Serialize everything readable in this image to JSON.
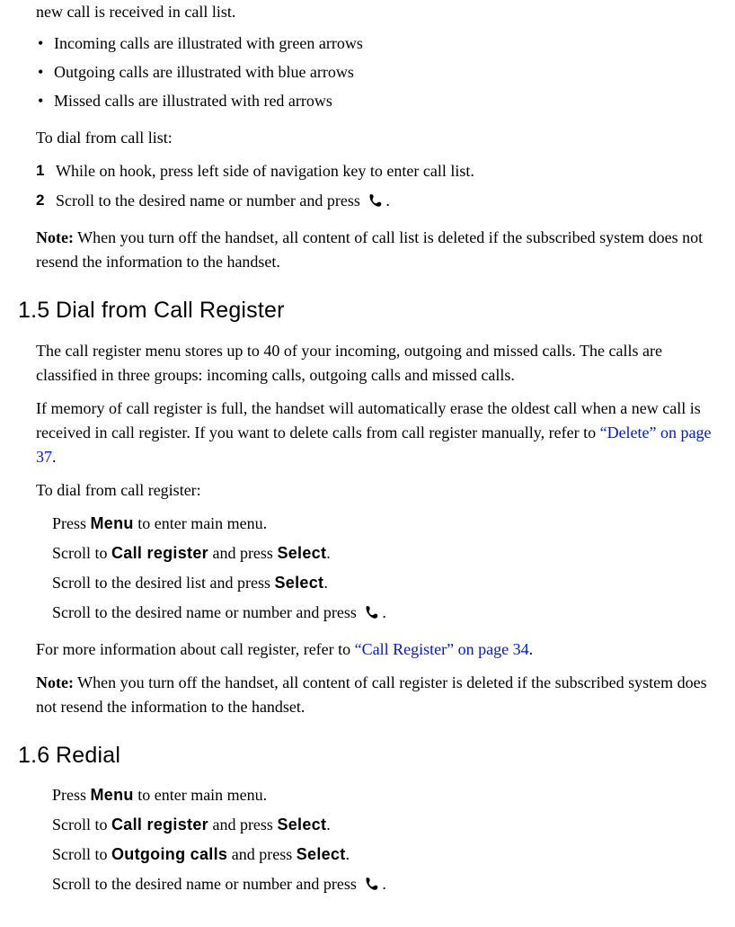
{
  "intro_line": "new call is received in call list.",
  "bullets": [
    "Incoming calls are illustrated with green arrows",
    "Outgoing calls are illustrated with blue arrows",
    "Missed calls are illustrated with red arrows"
  ],
  "to_dial_call_list": "To dial from call list:",
  "steps_call_list": {
    "n1": "1",
    "t1": "While on hook, press left side of navigation key to enter call list.",
    "n2": "2",
    "t2a": "Scroll to the desired name or number and press ",
    "t2b": "."
  },
  "note1": {
    "label": "Note:",
    "text": " When you turn off the handset, all content of call list is deleted if the subscribed system does not resend the information to the handset."
  },
  "sec15": {
    "num": "1.5",
    "title": "Dial from Call Register",
    "p1": "The call register menu stores up to 40 of your incoming, outgoing and missed calls. The calls are classified in three groups: incoming calls, outgoing calls and missed calls.",
    "p2a": "If memory of call register is full, the handset will automatically erase the oldest call when a new call is received in call register. If you want to delete calls from call register manually, refer to ",
    "p2link": "“Delete” on page 37",
    "p2b": ".",
    "to_dial": "To dial from call register:",
    "s1a": "Press ",
    "s1b": " to enter main menu.",
    "s2a": "Scroll to ",
    "s2b": " and press ",
    "s2c": ".",
    "s3a": "Scroll to the desired list and press ",
    "s3b": ".",
    "s4a": "Scroll to the desired name or number and press ",
    "s4b": ".",
    "more_a": "For more information about call register, refer to ",
    "more_link": "“Call Register” on page 34",
    "more_b": "."
  },
  "note2": {
    "label": "Note:",
    "text": " When you turn off the handset, all content of call register is deleted if the subscribed system does not resend the information to the handset."
  },
  "sec16": {
    "num": "1.6",
    "title": "Redial",
    "s1a": "Press ",
    "s1b": " to enter main menu.",
    "s2a": "Scroll to ",
    "s2b": " and press ",
    "s2c": ".",
    "s3a": "Scroll to ",
    "s3b": " and press ",
    "s3c": ".",
    "s4a": "Scroll to the desired name or number and press ",
    "s4b": "."
  },
  "ui": {
    "menu": "Menu",
    "call_register": "Call register",
    "select": "Select",
    "outgoing_calls": "Outgoing calls"
  }
}
